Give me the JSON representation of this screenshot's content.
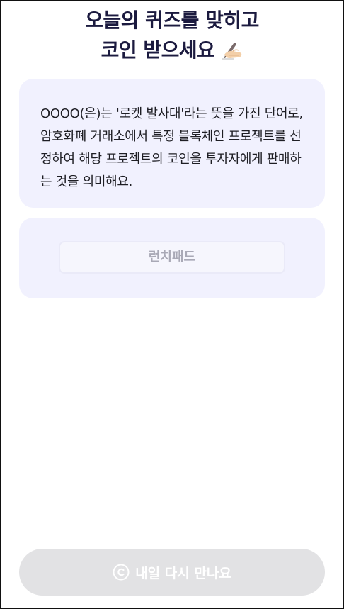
{
  "header": {
    "title_line1": "오늘의 퀴즈를 맞히고",
    "title_line2": "코인 받으세요",
    "title_icon": "writing-hand-icon"
  },
  "quiz": {
    "question": "OOOO(은)는 '로켓 발사대'라는 뜻을 가진 단어로, 암호화폐 거래소에서 특정 블록체인 프로젝트를 선정하여 해당 프로젝트의 코인을 투자자에게 판매하는 것을 의미해요.",
    "options": [
      "런치패드"
    ]
  },
  "footer": {
    "button_label": "내일 다시 만나요",
    "button_icon": "coin-icon",
    "button_color": "#e2e2e4"
  },
  "colors": {
    "title": "#1b1a3f",
    "card_background": "#f1f1fe",
    "option_text": "#a9a9b6"
  }
}
